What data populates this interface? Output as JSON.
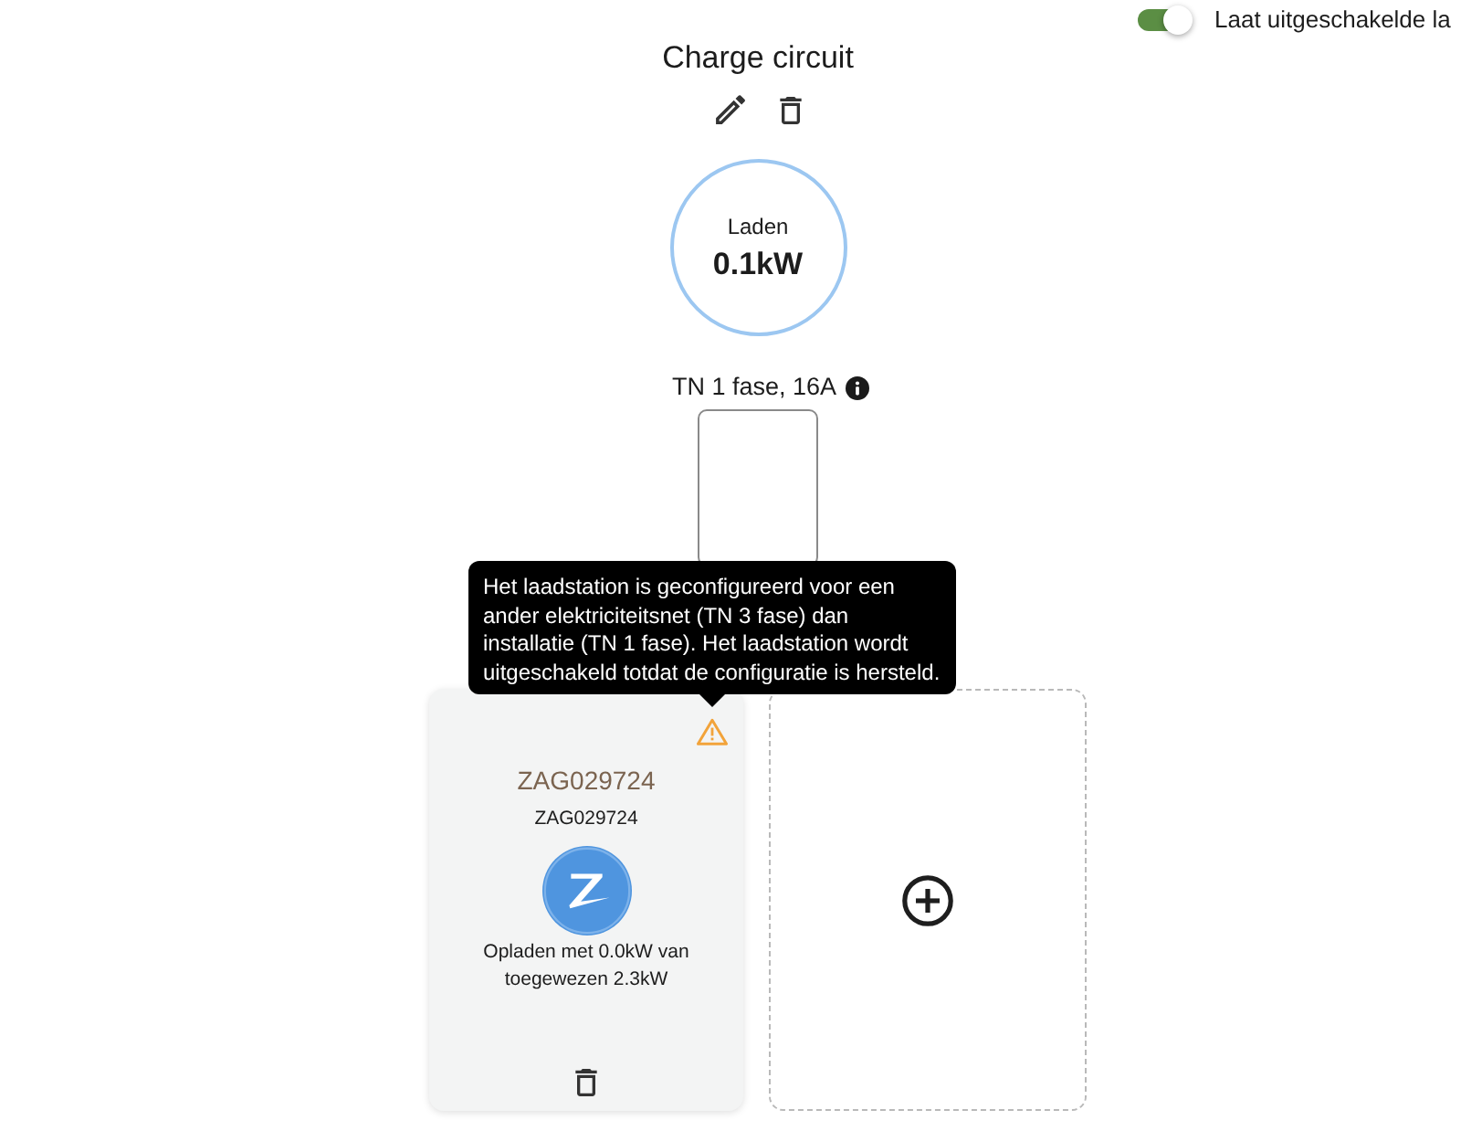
{
  "display_toggle": {
    "label": "Laat uitgeschakelde la",
    "on": true
  },
  "circuit": {
    "title": "Charge circuit",
    "power": {
      "label": "Laden",
      "value": "0.1kW"
    },
    "grid": "TN 1 fase, 16A"
  },
  "chargers": [
    {
      "name": "ZAG029724",
      "serial": "ZAG029724",
      "status": "Opladen met 0.0kW van toegewezen 2.3kW",
      "warning": true,
      "warning_tooltip": "Het laadstation is geconfigureerd voor een ander elektriciteitsnet (TN 3 fase) dan installatie (TN 1 fase). Het laadstation wordt uitgeschakeld totdat de configuratie is hersteld."
    }
  ]
}
